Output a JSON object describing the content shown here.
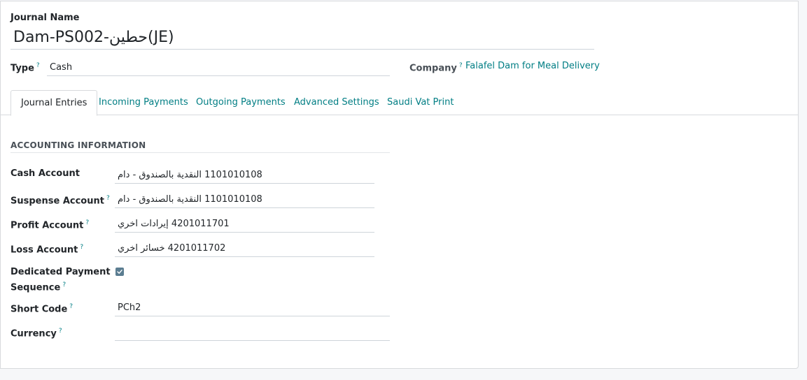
{
  "form": {
    "journal_name_label": "Journal Name",
    "journal_name_value": "Dam-PS002-حطين(JE)",
    "type_label": "Type",
    "type_value": "Cash",
    "company_label": "Company",
    "company_value": "Falafel Dam for Meal Delivery"
  },
  "tabs": [
    {
      "label": "Journal Entries",
      "active": true
    },
    {
      "label": "Incoming Payments",
      "active": false
    },
    {
      "label": "Outgoing Payments",
      "active": false
    },
    {
      "label": "Advanced Settings",
      "active": false
    },
    {
      "label": "Saudi Vat Print",
      "active": false
    }
  ],
  "accounting": {
    "section_title": "ACCOUNTING INFORMATION",
    "cash_account_label": "Cash Account",
    "cash_account_value": "1101010108 النقدية بالصندوق - دام",
    "suspense_account_label": "Suspense Account",
    "suspense_account_value": "1101010108 النقدية بالصندوق - دام",
    "profit_account_label": "Profit Account",
    "profit_account_value": "4201011701 إيرادات اخري",
    "loss_account_label": "Loss Account",
    "loss_account_value": "4201011702 خسائر اخري",
    "dedicated_label_1": "Dedicated Payment",
    "dedicated_label_2": "Sequence",
    "dedicated_checked": true,
    "short_code_label": "Short Code",
    "short_code_value": "PCh2",
    "currency_label": "Currency",
    "currency_value": ""
  },
  "help_mark": "?",
  "colors": {
    "accent": "#017e84",
    "checkbox": "#5b7d91",
    "border": "#d8dadd"
  }
}
